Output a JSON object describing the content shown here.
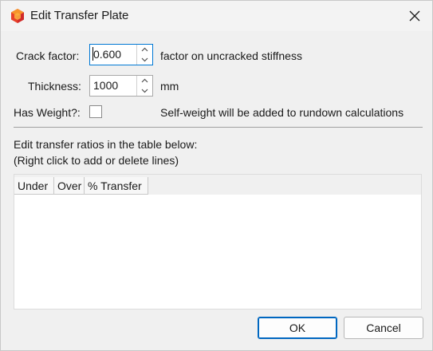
{
  "window": {
    "title": "Edit Transfer Plate",
    "app_icon": "hexagon-app-icon",
    "close_icon": "close-icon"
  },
  "form": {
    "crack_factor": {
      "label": "Crack factor:",
      "value": "0.600",
      "suffix": "factor on uncracked stiffness"
    },
    "thickness": {
      "label": "Thickness:",
      "value": "1000",
      "suffix": "mm"
    },
    "has_weight": {
      "label": "Has Weight?:",
      "checked": false,
      "note": "Self-weight will be added to rundown calculations"
    }
  },
  "instructions": {
    "line1": "Edit transfer ratios in the table below:",
    "line2": "(Right click to add or delete lines)"
  },
  "table": {
    "columns": [
      "Under",
      "Over",
      "% Transfer"
    ],
    "rows": []
  },
  "buttons": {
    "ok": "OK",
    "cancel": "Cancel"
  },
  "colors": {
    "accent": "#0078d4",
    "icon_orange": "#f05a28",
    "icon_red": "#d9232d"
  }
}
